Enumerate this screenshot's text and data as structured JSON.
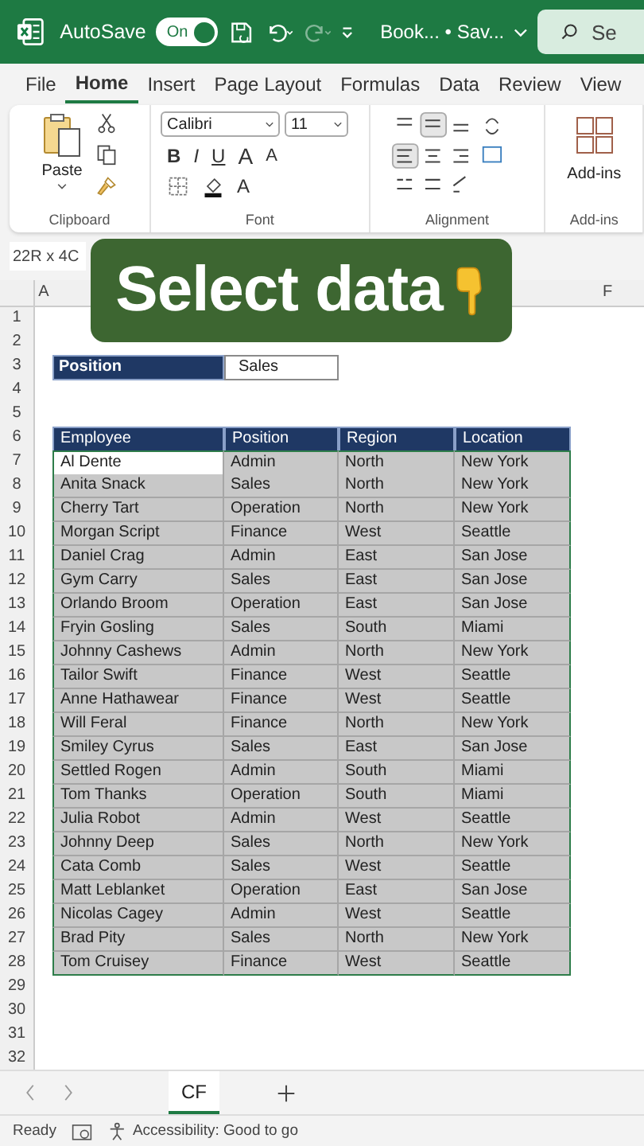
{
  "title_bar": {
    "autosave_label": "AutoSave",
    "autosave": {
      "label": "On",
      "on": true
    },
    "redo_disabled": true,
    "document_title": "Book... • Sav...",
    "search_placeholder": "Se"
  },
  "tabs": [
    {
      "label": "File",
      "selected": false
    },
    {
      "label": "Home",
      "selected": true
    },
    {
      "label": "Insert",
      "selected": false
    },
    {
      "label": "Page Layout",
      "selected": false
    },
    {
      "label": "Formulas",
      "selected": false
    },
    {
      "label": "Data",
      "selected": false
    },
    {
      "label": "Review",
      "selected": false
    },
    {
      "label": "View",
      "selected": false
    }
  ],
  "ribbon": {
    "clipboard": {
      "paste_label": "Paste",
      "group_label": "Clipboard"
    },
    "font": {
      "font_name": "Calibri",
      "font_size": "11",
      "style_buttons": [
        "B",
        "I",
        "U"
      ],
      "grow_label": "A",
      "shrink_label": "A",
      "color_label": "A",
      "group_label": "Font"
    },
    "alignment": {
      "group_label": "Alignment"
    },
    "addins": {
      "label": "Add-ins",
      "group_label": "Add-ins"
    }
  },
  "name_box": "22R x 4C",
  "overlay": {
    "text": "Select data"
  },
  "column_headers": {
    "first": "A",
    "last": "F"
  },
  "row_numbers": [
    "1",
    "2",
    "3",
    "4",
    "5",
    "6",
    "7",
    "8",
    "9",
    "10",
    "11",
    "12",
    "13",
    "14",
    "15",
    "16",
    "17",
    "18",
    "19",
    "20",
    "21",
    "22",
    "23",
    "24",
    "25",
    "26",
    "27",
    "28",
    "29",
    "30",
    "31",
    "32"
  ],
  "filter": {
    "label": "Position",
    "value": "Sales"
  },
  "table": {
    "columns": [
      "Employee",
      "Position",
      "Region",
      "Location"
    ],
    "rows": [
      {
        "cells": [
          "Al Dente",
          "Admin",
          "North",
          "New York"
        ],
        "active": true
      },
      {
        "cells": [
          "Anita Snack",
          "Sales",
          "North",
          "New York"
        ],
        "active": false
      },
      {
        "cells": [
          "Cherry Tart",
          "Operation",
          "North",
          "New York"
        ],
        "active": false
      },
      {
        "cells": [
          "Morgan Script",
          "Finance",
          "West",
          "Seattle"
        ],
        "active": false
      },
      {
        "cells": [
          "Daniel Crag",
          "Admin",
          "East",
          "San Jose"
        ],
        "active": false
      },
      {
        "cells": [
          "Gym Carry",
          "Sales",
          "East",
          "San Jose"
        ],
        "active": false
      },
      {
        "cells": [
          "Orlando Broom",
          "Operation",
          "East",
          "San Jose"
        ],
        "active": false
      },
      {
        "cells": [
          "Fryin Gosling",
          "Sales",
          "South",
          "Miami"
        ],
        "active": false
      },
      {
        "cells": [
          "Johnny Cashews",
          "Admin",
          "North",
          "New York"
        ],
        "active": false
      },
      {
        "cells": [
          "Tailor Swift",
          "Finance",
          "West",
          "Seattle"
        ],
        "active": false
      },
      {
        "cells": [
          "Anne Hathawear",
          "Finance",
          "West",
          "Seattle"
        ],
        "active": false
      },
      {
        "cells": [
          "Will Feral",
          "Finance",
          "North",
          "New York"
        ],
        "active": false
      },
      {
        "cells": [
          "Smiley Cyrus",
          "Sales",
          "East",
          "San Jose"
        ],
        "active": false
      },
      {
        "cells": [
          "Settled Rogen",
          "Admin",
          "South",
          "Miami"
        ],
        "active": false
      },
      {
        "cells": [
          "Tom Thanks",
          "Operation",
          "South",
          "Miami"
        ],
        "active": false
      },
      {
        "cells": [
          "Julia Robot",
          "Admin",
          "West",
          "Seattle"
        ],
        "active": false
      },
      {
        "cells": [
          "Johnny Deep",
          "Sales",
          "North",
          "New York"
        ],
        "active": false
      },
      {
        "cells": [
          "Cata Comb",
          "Sales",
          "West",
          "Seattle"
        ],
        "active": false
      },
      {
        "cells": [
          "Matt Leblanket",
          "Operation",
          "East",
          "San Jose"
        ],
        "active": false
      },
      {
        "cells": [
          "Nicolas Cagey",
          "Admin",
          "West",
          "Seattle"
        ],
        "active": false
      },
      {
        "cells": [
          "Brad Pity",
          "Sales",
          "North",
          "New York"
        ],
        "active": false
      },
      {
        "cells": [
          "Tom Cruisey",
          "Finance",
          "West",
          "Seattle"
        ],
        "active": false
      }
    ]
  },
  "sheet_tabs": [
    {
      "label": "CF",
      "selected": true
    }
  ],
  "status_bar": {
    "ready": "Ready",
    "accessibility": "Accessibility: Good to go"
  }
}
